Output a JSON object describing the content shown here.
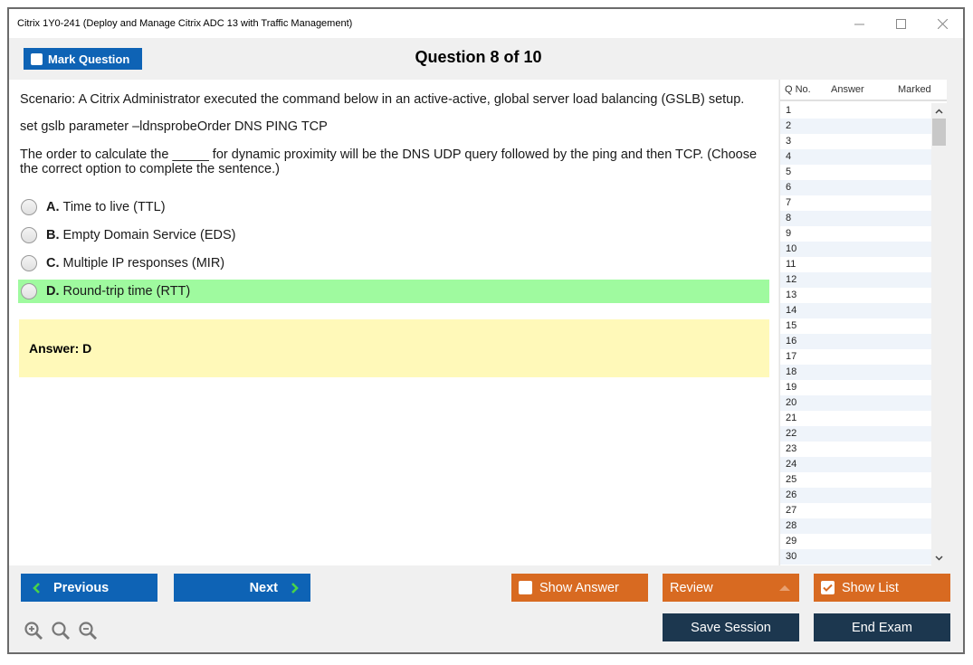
{
  "window": {
    "title": "Citrix 1Y0-241 (Deploy and Manage Citrix ADC 13 with Traffic Management)",
    "controls": [
      "minimize",
      "maximize",
      "close"
    ]
  },
  "header": {
    "mark_label": "Mark Question",
    "mark_checked": false,
    "question_title": "Question 8 of 10"
  },
  "question": {
    "scenario": "Scenario: A Citrix Administrator executed the command below in an active-active, global server load balancing (GSLB) setup.",
    "command": "set gslb parameter –ldnsprobeOrder DNS PING TCP",
    "prompt_line1": "The order to calculate the _____ for dynamic proximity will be the DNS UDP query followed by the ping and then TCP. (Choose",
    "prompt_line2": "the correct option to complete the sentence.)",
    "options": [
      {
        "letter": "A.",
        "text": "Time to live (TTL)",
        "correct": false
      },
      {
        "letter": "B.",
        "text": "Empty Domain Service (EDS)",
        "correct": false
      },
      {
        "letter": "C.",
        "text": "Multiple IP responses (MIR)",
        "correct": false
      },
      {
        "letter": "D.",
        "text": "Round-trip time (RTT)",
        "correct": true
      }
    ],
    "answer_text": "Answer: D"
  },
  "question_list": {
    "columns": [
      "Q No.",
      "Answer",
      "Marked"
    ],
    "rows": [
      "1",
      "2",
      "3",
      "4",
      "5",
      "6",
      "7",
      "8",
      "9",
      "10",
      "11",
      "12",
      "13",
      "14",
      "15",
      "16",
      "17",
      "18",
      "19",
      "20",
      "21",
      "22",
      "23",
      "24",
      "25",
      "26",
      "27",
      "28",
      "29",
      "30"
    ]
  },
  "footer": {
    "previous_label": "Previous",
    "next_label": "Next",
    "show_answer_label": "Show Answer",
    "show_answer_checked": false,
    "review_label": "Review",
    "show_list_label": "Show List",
    "show_list_checked": true,
    "save_session_label": "Save Session",
    "end_exam_label": "End Exam",
    "zoom_icons": [
      "zoom-in-icon",
      "zoom-reset-icon",
      "zoom-out-icon"
    ]
  },
  "colors": {
    "primary_blue": "#0e63b5",
    "orange": "#d86a21",
    "navy": "#1c374f",
    "correct_green": "#9ffa9f",
    "answer_yellow": "#fff9b9"
  }
}
